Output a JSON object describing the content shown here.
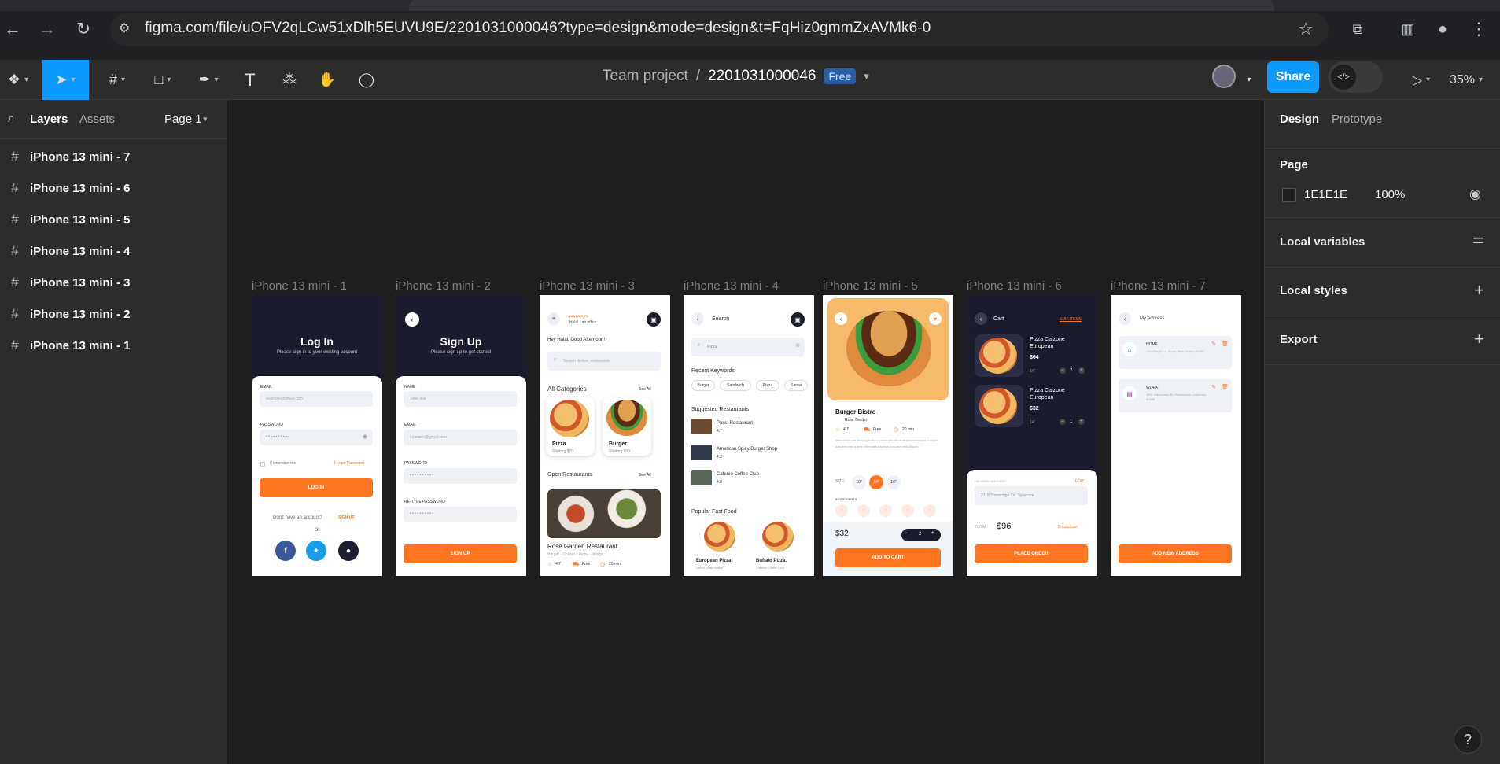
{
  "browser": {
    "url": "figma.com/file/uOFV2qLCw51xDlh5EUVU9E/2201031000046?type=design&mode=design&t=FqHiz0gmmZxAVMk6-0"
  },
  "header": {
    "team": "Team project",
    "separator": "/",
    "file_name": "2201031000046",
    "plan_badge": "Free",
    "share_label": "Share",
    "zoom": "35%"
  },
  "left_panel": {
    "tab_layers": "Layers",
    "tab_assets": "Assets",
    "page_selector": "Page 1",
    "layers": [
      "iPhone 13 mini - 7",
      "iPhone 13 mini - 6",
      "iPhone 13 mini - 5",
      "iPhone 13 mini - 4",
      "iPhone 13 mini - 3",
      "iPhone 13 mini - 2",
      "iPhone 13 mini - 1"
    ]
  },
  "right_panel": {
    "tab_design": "Design",
    "tab_prototype": "Prototype",
    "page_heading": "Page",
    "page_color": "1E1E1E",
    "page_opacity": "100%",
    "local_variables": "Local variables",
    "local_styles": "Local styles",
    "export": "Export"
  },
  "canvas": {
    "frame_labels": [
      "iPhone 13 mini - 1",
      "iPhone 13 mini - 2",
      "iPhone 13 mini - 3",
      "iPhone 13 mini - 4",
      "iPhone 13 mini - 5",
      "iPhone 13 mini - 6",
      "iPhone 13 mini - 7"
    ],
    "f1": {
      "title": "Log In",
      "subtitle": "Please sign in to your existing account",
      "email": "EMAIL",
      "email_ph": "example@gmail.com",
      "password": "PASSWORD",
      "pw_dots": "• • • • • • • • • •",
      "remember": "Remember me",
      "forgot": "Forgot Password",
      "btn": "LOG IN",
      "no_account": "Don't have an account?",
      "signup": "SIGN UP",
      "or": "Or"
    },
    "f2": {
      "title": "Sign Up",
      "subtitle": "Please sign up to get started",
      "name": "NAME",
      "name_ph": "John doe",
      "email": "EMAIL",
      "email_ph": "example@gmail.com",
      "password": "PASSWORD",
      "pw_dots": "• • • • • • • • • •",
      "retype": "RE-TYPE PASSWORD",
      "btn": "SIGN UP"
    },
    "f3": {
      "deliver_to": "DELIVER TO",
      "location": "Halal Lab office",
      "greeting": "Hey Halal, Good Afternoon!",
      "search_ph": "Search dishes, restaurants",
      "all_categories": "All Categories",
      "see_all": "See All",
      "cat1": "Pizza",
      "cat1_price": "Starting   $70",
      "cat2": "Burger",
      "cat2_price": "Starting   $50",
      "open_restaurants": "Open Restaurants",
      "see_all2": "See All",
      "restaurant": "Rose Garden Restaurant",
      "rest_tags": "Burger - Chiken - Riche - Wings",
      "rest_rating": "4.7",
      "rest_fee": "Free",
      "rest_time": "20 min"
    },
    "f4": {
      "title": "Search",
      "query": "Pizza",
      "recent": "Recent Keywords",
      "chips": [
        "Burger",
        "Sandwich",
        "Pizza",
        "Sanwi"
      ],
      "suggested": "Suggested Restaurants",
      "r1": "Pansi Restaurant",
      "r1_rating": "4.7",
      "r2": "American Spicy Burger Shop",
      "r2_rating": "4.3",
      "r3": "Cafenio Coffee Club",
      "r3_rating": "4.0",
      "popular": "Popular Fast Food",
      "p1": "European Pizza",
      "p1_sub": "Uttora Coffe House",
      "p2": "Buffalo Pizza.",
      "p2_sub": "Cafenio Coffee Club"
    },
    "f5": {
      "name": "Burger Bistro",
      "rest": "Rose Garden",
      "rating": "4.7",
      "fee": "Free",
      "time": "20 min",
      "desc": "Maecenas sed diam eget risus varius blandit sit amet non magna. Integer posuere erat a ante venenatis dapibus posuere velit aliquet.",
      "size_label": "SIZE:",
      "sizes": [
        "10\"",
        "14\"",
        "16\""
      ],
      "ingredients": "INGREDIENTS",
      "price": "$32",
      "qty": "2",
      "btn": "ADD TO CART"
    },
    "f6": {
      "title": "Cart",
      "edit": "EDIT ITEMS",
      "i1_name": "Pizza Calzone European",
      "i1_price": "$64",
      "i1_size": "14\"",
      "i1_qty": "2",
      "i2_name": "Pizza Calzone European",
      "i2_price": "$32",
      "i2_size": "14\"",
      "i2_qty": "1",
      "addr_label": "DELIVERY ADDRESS",
      "addr_edit": "EDIT",
      "address": "2118 Thornridge Cir. Syracuse",
      "total_label": "TOTAL:",
      "total": "$96",
      "breakdown": "Breakdown",
      "btn": "PLACE ORDER"
    },
    "f7": {
      "title": "My Address",
      "a1_label": "HOME",
      "a1_text": "2464 Royal Ln. Mesa, New Jersey 45463",
      "a2_label": "WORK",
      "a2_text": "3891 Ranchview Dr. Richardson, California 62639",
      "btn": "ADD NEW ADDRESS"
    }
  },
  "colors": {
    "accent": "#0d99ff",
    "orange": "#ff7622",
    "dark_header": "#1b1b2e"
  }
}
